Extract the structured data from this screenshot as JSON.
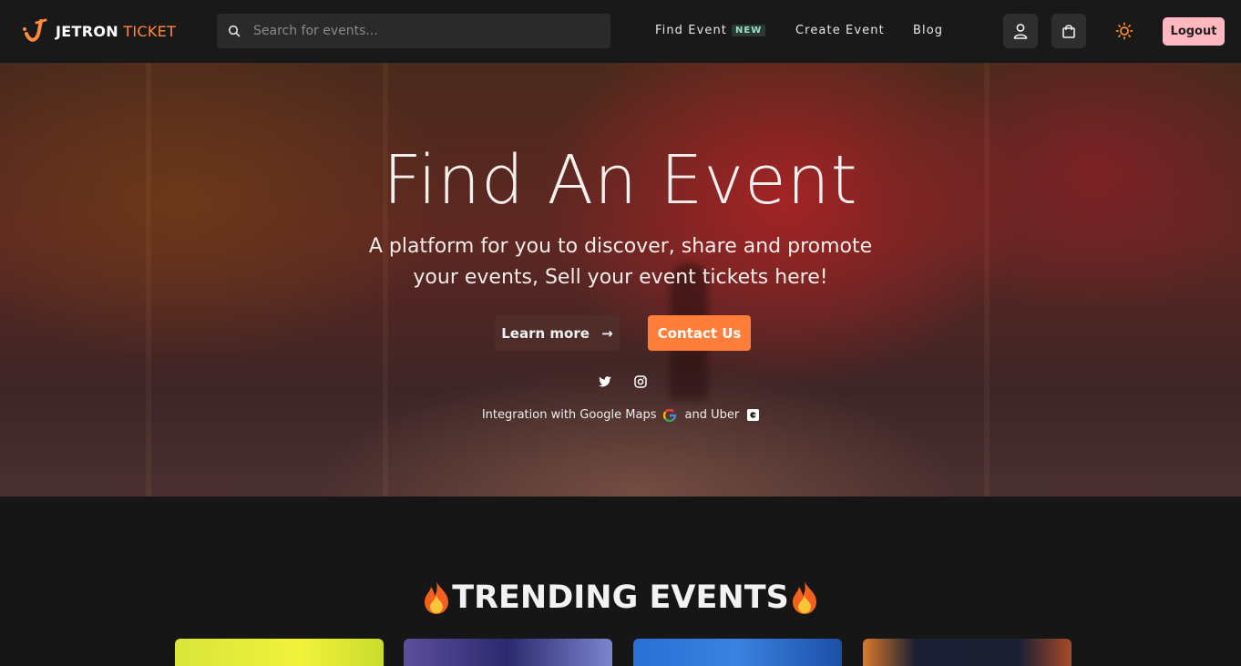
{
  "brand": {
    "name_primary": "JETRON",
    "name_secondary": "TICKET",
    "accent": "#ff8a3d"
  },
  "search": {
    "placeholder": "Search for events..."
  },
  "nav": {
    "find_event": "Find Event",
    "new_badge": "NEW",
    "create_event": "Create Event",
    "blog": "Blog"
  },
  "actions": {
    "logout": "Logout",
    "icons": [
      "user-icon",
      "shopping-bag-icon",
      "sun-icon"
    ]
  },
  "hero": {
    "title": "Find An Event",
    "subtitle": "A platform for you to discover, share and promote your events, Sell your event tickets here!",
    "learn_more": "Learn more",
    "learn_more_arrow": "→",
    "contact_us": "Contact Us",
    "social_icons": [
      "twitter-icon",
      "instagram-icon"
    ],
    "integration_prefix": "Integration with Google Maps",
    "integration_and": "and Uber"
  },
  "trending": {
    "title": "TRENDING EVENTS"
  },
  "colors": {
    "contact_button": "#ff7f3a",
    "logout_button": "#ffb7c0",
    "new_badge_text": "#9ee0c4"
  }
}
